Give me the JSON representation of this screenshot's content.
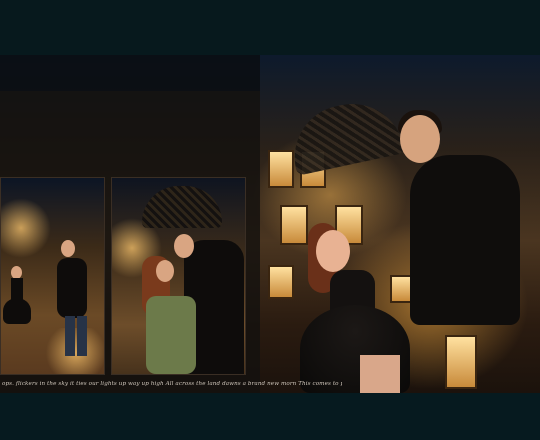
{
  "caption": {
    "text": "ops. flickers in the sky it ties our lights up way up high All across the land dawns a brand new morn This comes to pass when a child is born"
  },
  "photos": {
    "main_alt": "couple-under-umbrella-night-scene",
    "inset_left_alt": "couple-holding-hands-night-street",
    "inset_right_alt": "couple-kissing-under-umbrella"
  }
}
